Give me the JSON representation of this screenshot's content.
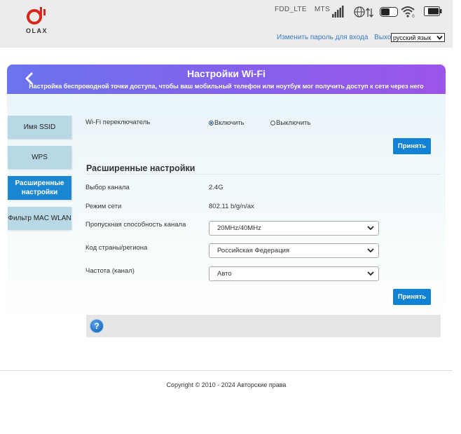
{
  "brand": {
    "logo_text": "OLAX",
    "accent": "#d9241b"
  },
  "status": {
    "network_type": "FDD_LTE",
    "operator": "MTS"
  },
  "top_links": {
    "change_password": "Изменить пароль для входа",
    "logout": "Выход"
  },
  "language": {
    "selected": "русский язык"
  },
  "header": {
    "title": "Настройки Wi-Fi",
    "subtitle": "Настройка беспроводной точки доступа, чтобы ваш мобильный телефон или ноутбук мог получить доступ к сети через него"
  },
  "nav": {
    "items": [
      {
        "label": "Имя SSID",
        "active": false
      },
      {
        "label": "WPS",
        "active": false
      },
      {
        "label": "Расширенные настройки",
        "active": true
      },
      {
        "label": "Фильтр MAC WLAN",
        "active": false
      }
    ]
  },
  "wifi_switch": {
    "label": "Wi-Fi переключатель",
    "on_label": "Включить",
    "off_label": "Выключить",
    "selected": "on"
  },
  "apply_label": "Принять",
  "advanced": {
    "title": "Расширенные настройки",
    "channel_label": "Выбор канала",
    "channel_value": "2.4G",
    "mode_label": "Режим сети",
    "mode_value": "802.11 b/g/n/ax",
    "bandwidth_label": "Пропускная способность канала",
    "bandwidth_value": "20MHz/40MHz",
    "country_label": "Код страны/региона",
    "country_value": "Российская Федерация",
    "frequency_label": "Частота (канал)",
    "frequency_value": "Авто"
  },
  "help": {
    "icon_glyph": "?"
  },
  "footer": {
    "copyright": "Copyright © 2010 - 2024 Авторские права"
  },
  "colors": {
    "primary": "#1182d4",
    "header_start": "#6a74ee",
    "header_end": "#9b55e8",
    "nav_idle": "#b9d8e6"
  }
}
